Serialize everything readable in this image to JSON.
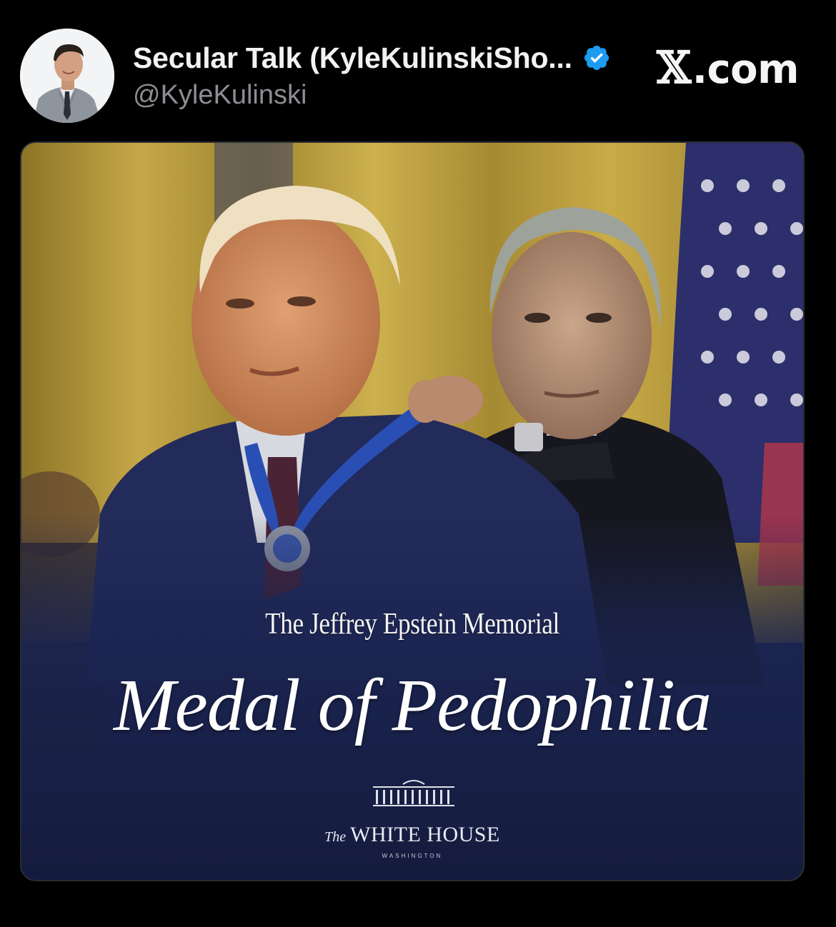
{
  "post": {
    "author": {
      "display_name": "Secular Talk (KyleKulinskiSho...",
      "handle": "@KyleKulinski",
      "verified_icon": "verified-badge-icon",
      "avatar_icon": "avatar"
    },
    "site_label": {
      "x_mark": "𝕏",
      "text": ".com"
    },
    "media": {
      "caption_top": "The Jeffrey Epstein Memorial",
      "caption_main": "Medal of Pedophilia",
      "logo": {
        "the": "The",
        "name": "WHITE HOUSE",
        "sub": "WASHINGTON"
      }
    }
  },
  "colors": {
    "background": "#000000",
    "verified_blue": "#1d9bf0",
    "handle_gray": "#8b8e92",
    "suit_navy": "#1b2450",
    "curtain_gold": "#b89a36"
  }
}
